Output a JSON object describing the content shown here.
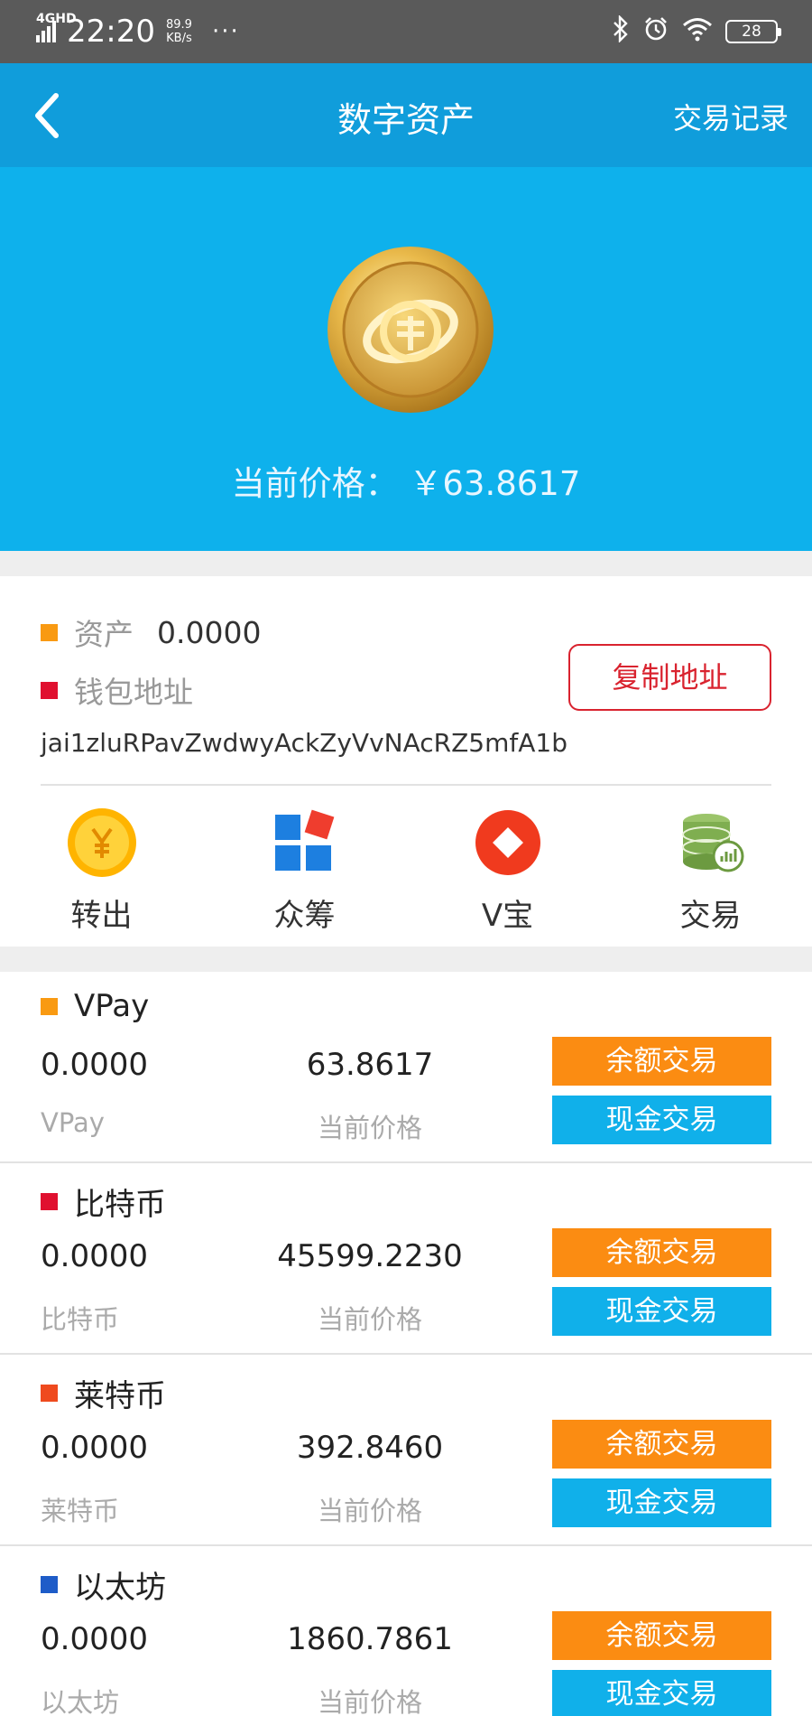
{
  "status_bar": {
    "network": "4GHD",
    "time": "22:20",
    "speed_value": "89.9",
    "speed_unit": "KB/s",
    "more": "···",
    "battery": "28"
  },
  "header": {
    "title": "数字资产",
    "right_link": "交易记录"
  },
  "hero": {
    "price_text": "当前价格： ￥63.8617"
  },
  "asset": {
    "label": "资产",
    "value": "0.0000",
    "wallet_label": "钱包地址",
    "copy_button": "复制地址",
    "address": "jai1zluRPavZwdwyAckZyVvNAcRZ5mfA1b"
  },
  "quick_actions": [
    {
      "label": "转出",
      "icon": "yuan-coin-icon"
    },
    {
      "label": "众筹",
      "icon": "crowdfund-blocks-icon"
    },
    {
      "label": "V宝",
      "icon": "v-treasure-icon"
    },
    {
      "label": "交易",
      "icon": "coin-stack-chart-icon"
    }
  ],
  "coins": [
    {
      "name": "VPay",
      "color": "#f99a12",
      "balance": "0.0000",
      "price": "63.8617",
      "sub_name": "VPay",
      "sub_price": "当前价格",
      "btn_balance": "余额交易",
      "btn_cash": "现金交易"
    },
    {
      "name": "比特币",
      "color": "#e0102f",
      "balance": "0.0000",
      "price": "45599.2230",
      "sub_name": "比特币",
      "sub_price": "当前价格",
      "btn_balance": "余额交易",
      "btn_cash": "现金交易"
    },
    {
      "name": "莱特币",
      "color": "#ef4a1e",
      "balance": "0.0000",
      "price": "392.8460",
      "sub_name": "莱特币",
      "sub_price": "当前价格",
      "btn_balance": "余额交易",
      "btn_cash": "现金交易"
    },
    {
      "name": "以太坊",
      "color": "#1e5cc8",
      "balance": "0.0000",
      "price": "1860.7861",
      "sub_name": "以太坊",
      "sub_price": "当前价格",
      "btn_balance": "余额交易",
      "btn_cash": "现金交易"
    }
  ],
  "colors": {
    "nav_blue": "#109ddb",
    "hero_blue": "#0eb1ec",
    "orange": "#fb8c12",
    "red": "#d9232f",
    "asset_square": "#f99a12",
    "wallet_square": "#e0102f"
  }
}
